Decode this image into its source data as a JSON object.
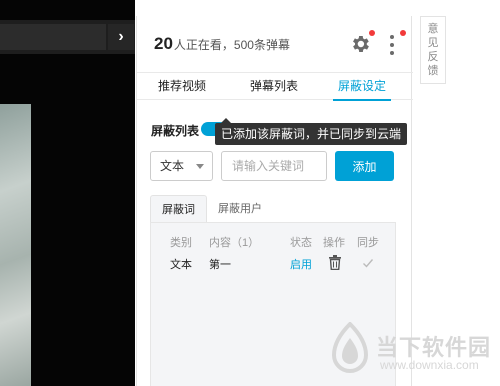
{
  "video": {
    "collapse_icon": "chevron-right-icon",
    "collapse_glyph": "›"
  },
  "header": {
    "viewer_count": "20",
    "viewer_text": "人正在看，500条弹幕",
    "settings_icon": "gear-icon",
    "more_icon": "more-vertical-icon",
    "notification_color": "#f23a3a"
  },
  "tabs": [
    {
      "label": "推荐视频"
    },
    {
      "label": "弹幕列表"
    },
    {
      "label": "屏蔽设定",
      "active": true
    }
  ],
  "accent_color": "#00a1d6",
  "block": {
    "title": "屏蔽列表",
    "toggle_on": true,
    "tooltip": "已添加该屏蔽词，并已同步到云端",
    "type_select": "文本",
    "keyword_placeholder": "请输入关键词",
    "add_label": "添加"
  },
  "subtabs": [
    {
      "label": "屏蔽词",
      "active": true
    },
    {
      "label": "屏蔽用户"
    }
  ],
  "table": {
    "headers": [
      "类别",
      "内容（1）",
      "状态",
      "操作",
      "同步"
    ],
    "rows": [
      {
        "type": "文本",
        "content": "第一",
        "status": "启用",
        "op_icon": "trash-icon",
        "sync_icon": "check-icon"
      }
    ]
  },
  "feedback": {
    "label": "意见反馈"
  },
  "watermark": {
    "cn": "当下软件园",
    "en": "www.downxia.com"
  }
}
